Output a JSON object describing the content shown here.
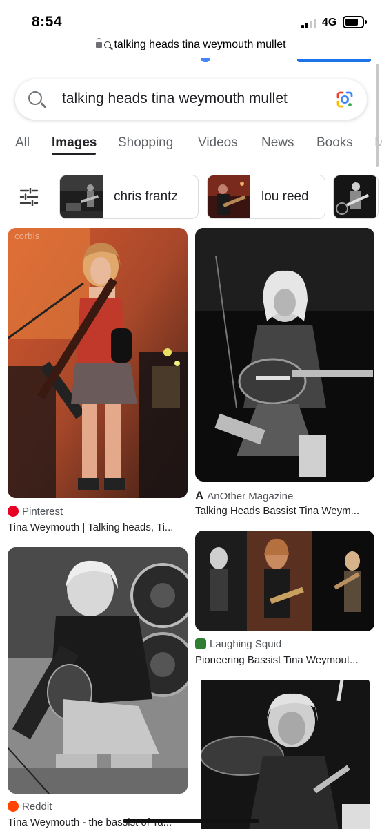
{
  "status_bar": {
    "time": "8:54",
    "network": "4G"
  },
  "browser": {
    "url": "talking heads tina weymouth mullet"
  },
  "search": {
    "query": "talking heads tina weymouth mullet"
  },
  "tabs": [
    {
      "label": "All"
    },
    {
      "label": "Images",
      "active": true
    },
    {
      "label": "Shopping"
    },
    {
      "label": "Videos"
    },
    {
      "label": "News"
    },
    {
      "label": "Books"
    }
  ],
  "chips": [
    {
      "label": "chris frantz"
    },
    {
      "label": "lou reed"
    }
  ],
  "results": [
    {
      "source": "Pinterest",
      "title": "Tina Weymouth | Talking heads, Ti...",
      "watermark": "corbis"
    },
    {
      "source": "AnOther Magazine",
      "title": "Talking Heads Bassist Tina Weym..."
    },
    {
      "source": "Reddit",
      "title": "Tina Weymouth - the bassist of Ta..."
    },
    {
      "source": "Laughing Squid",
      "title": "Pioneering Bassist Tina Weymout..."
    }
  ],
  "colors": {
    "google_blue": "#4285f4",
    "google_red": "#ea4335",
    "google_yellow": "#fbbc04",
    "google_green": "#34a853",
    "pinterest_red": "#e60023",
    "reddit_orange": "#ff4500",
    "laughing_squid_green": "#2e7d32"
  },
  "icons": {
    "lock": "lock-icon",
    "search": "search-icon",
    "lens": "google-lens-icon",
    "filter": "tune-filter-icon"
  }
}
